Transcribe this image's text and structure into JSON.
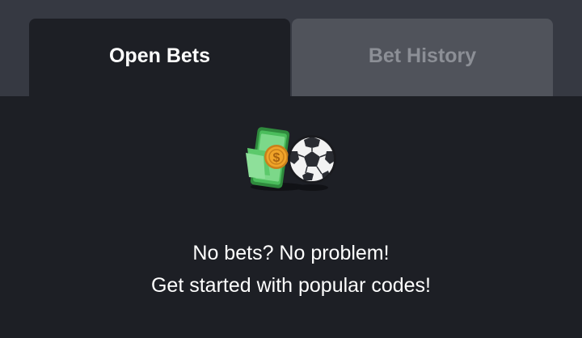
{
  "tabs": {
    "open_bets": "Open Bets",
    "bet_history": "Bet History"
  },
  "empty_state": {
    "illustration_icons": [
      "money-phone-icon",
      "soccer-ball-icon"
    ],
    "line1": "No bets? No problem!",
    "line2": "Get started with popular codes!"
  },
  "colors": {
    "background": "#1d1f25",
    "topbar": "#363942",
    "inactive_tab": "#50535b",
    "coin": "#f0a42a",
    "money_green": "#4bbd5c"
  }
}
